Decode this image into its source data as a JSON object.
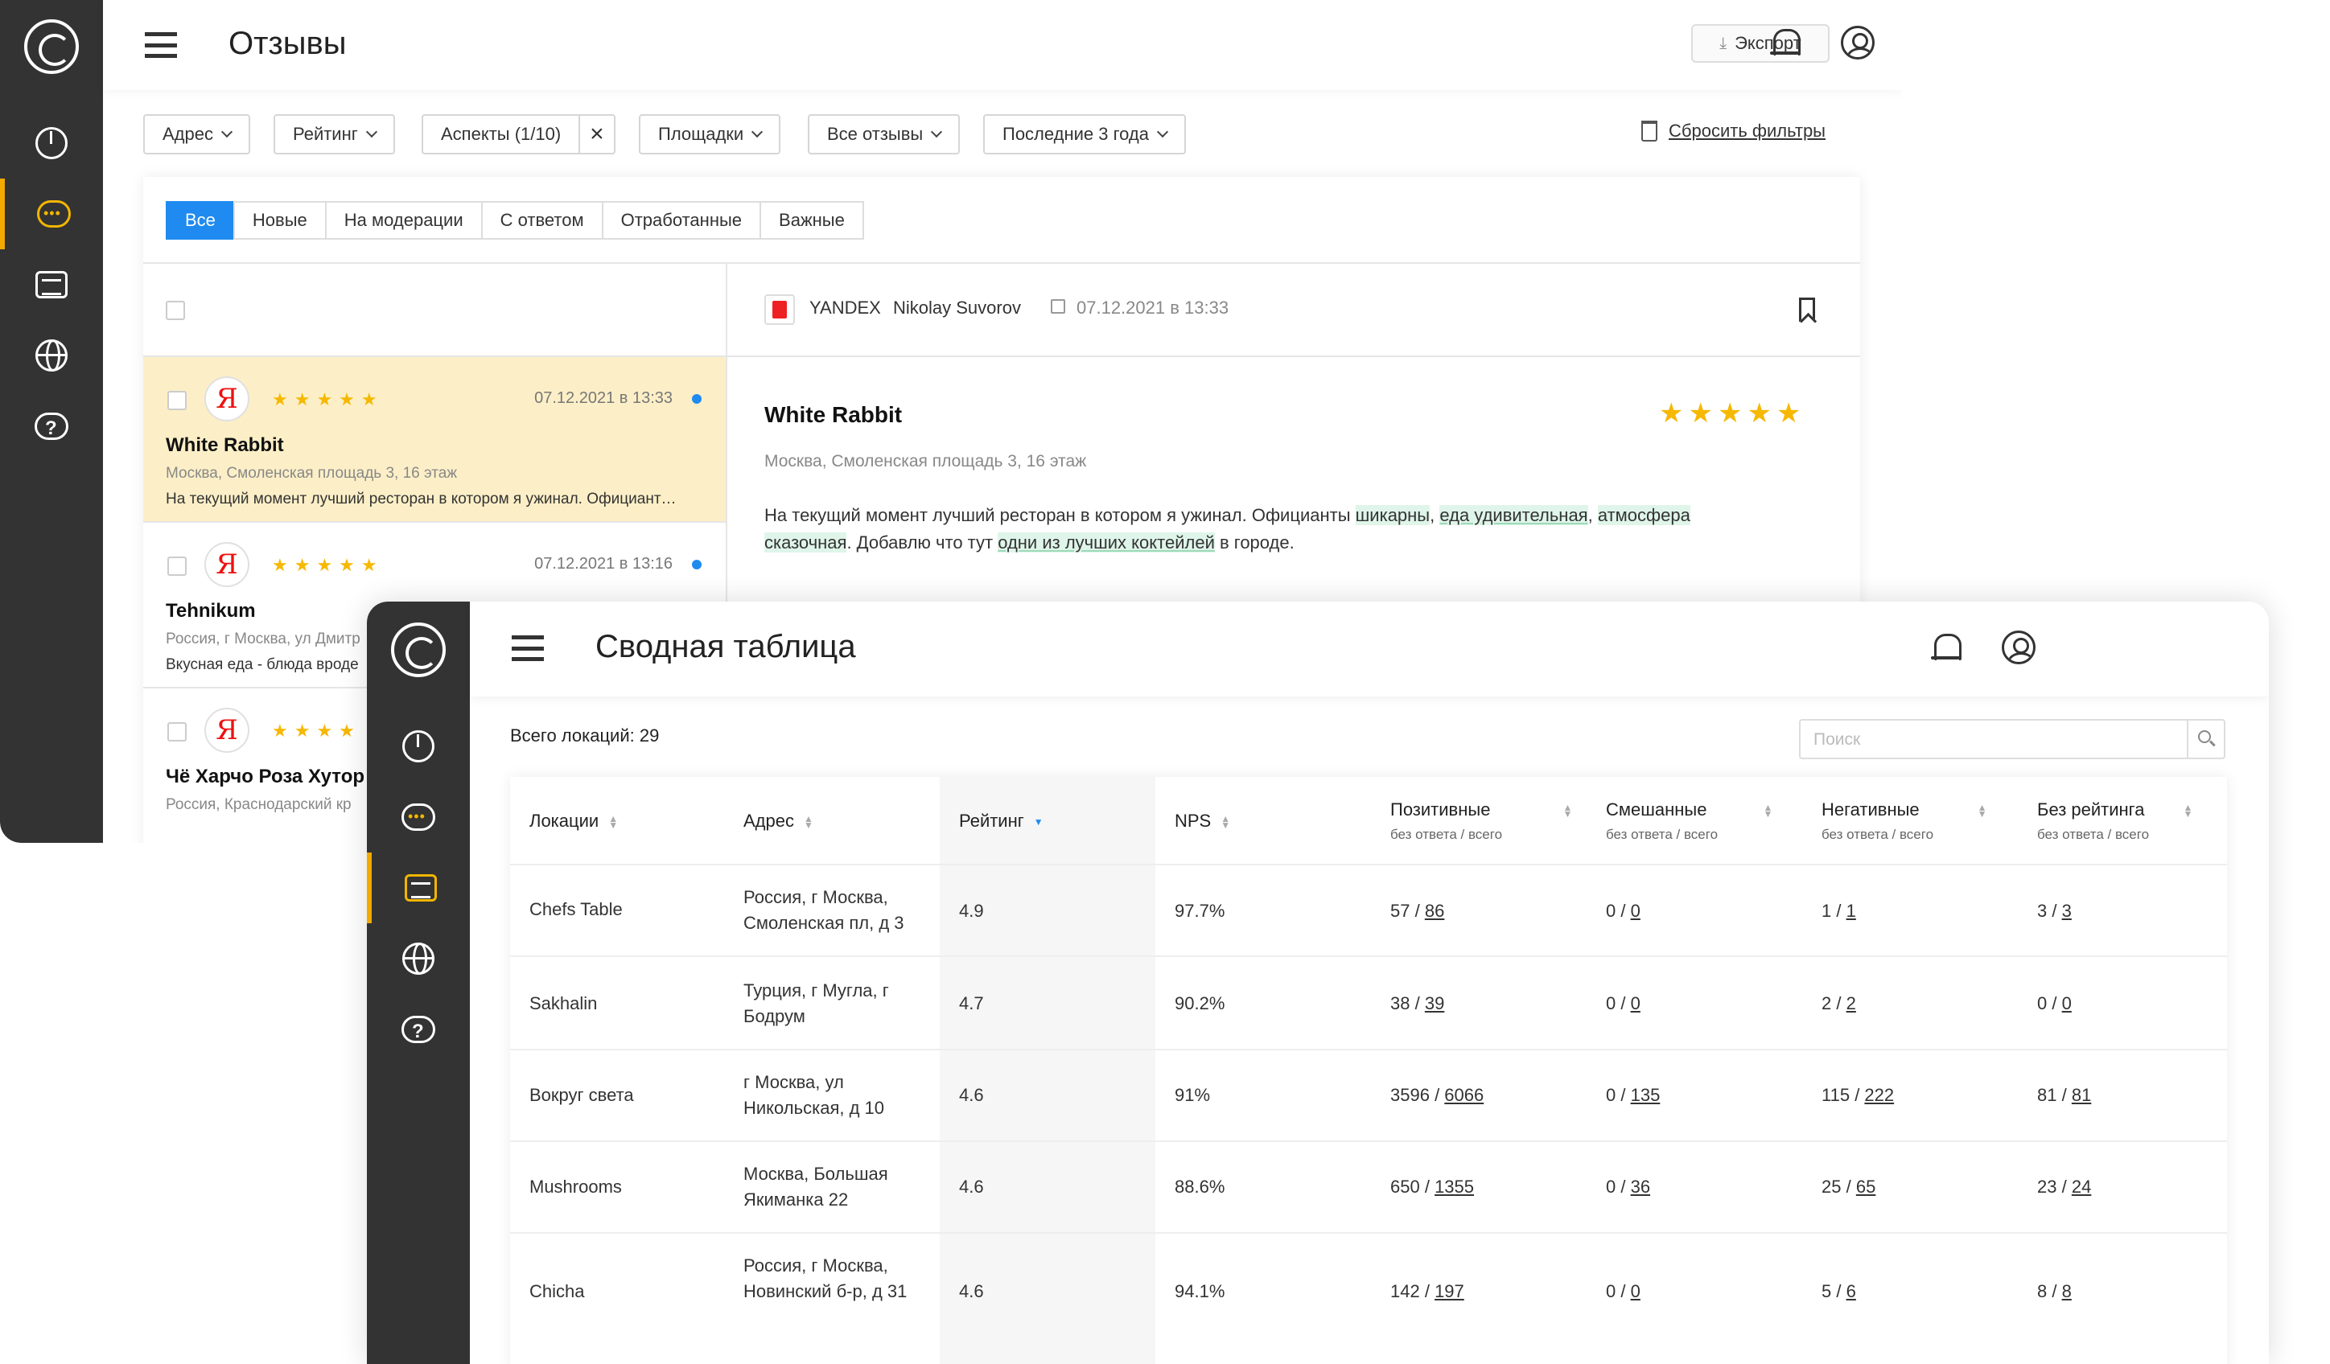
{
  "window_a": {
    "header": {
      "title": "Отзывы",
      "export_label": "Экспорт"
    },
    "filters": [
      {
        "label": "Адрес",
        "has_chevron": true
      },
      {
        "label": "Рейтинг",
        "has_chevron": true
      },
      {
        "label": "Аспекты (1/10)",
        "has_clear": true
      },
      {
        "label": "Площадки",
        "has_chevron": true
      },
      {
        "label": "Все отзывы",
        "has_chevron": true
      },
      {
        "label": "Последние 3 года",
        "has_chevron": true
      }
    ],
    "reset_label": "Сбросить фильтры",
    "tabs": [
      "Все",
      "Новые",
      "На модерации",
      "С ответом",
      "Отработанные",
      "Важные"
    ],
    "active_tab": "Все",
    "reviews": [
      {
        "stars": "★★★★★",
        "date": "07.12.2021 в 13:33",
        "name": "White Rabbit",
        "address": "Москва, Смоленская площадь 3, 16 этаж",
        "text": "На текущий момент лучший ресторан в котором я ужинал. Официант…",
        "selected": true
      },
      {
        "stars": "★★★★★",
        "date": "07.12.2021 в 13:16",
        "name": "Tehnikum",
        "address": "Россия, г Москва, ул Дмитр",
        "text": "Вкусная еда - блюда вроде",
        "selected": false
      },
      {
        "stars": "★★★★",
        "date": "",
        "name": "Чё Харчо Роза Хутор",
        "address": "Россия, Краснодарский кр",
        "text": "",
        "selected": false
      }
    ],
    "detail": {
      "platform": "YANDEX",
      "author": "Nikolay Suvorov",
      "date": "07.12.2021 в 13:33",
      "title": "White Rabbit",
      "stars": "★★★★★",
      "address": "Москва, Смоленская площадь 3, 16 этаж",
      "text_parts": {
        "p1": "На текущий момент лучший ресторан в котором я ужинал. Официанты ",
        "h1": "шикарны",
        "p2": ", ",
        "h2": "еда удивительная",
        "p3": ", ",
        "h3": "атмосфера сказочная",
        "p4": ". Добавлю что тут ",
        "h4": "одни из лучших коктейлей",
        "p5": " в городе."
      }
    },
    "colors": {
      "sidebar": "#333333",
      "accent": "#f2b600",
      "primary": "#1f8bf0",
      "selected_row": "#fcefc7",
      "highlight": "#dff5e9"
    }
  },
  "window_b": {
    "header": {
      "title": "Сводная таблица"
    },
    "total_label": "Всего локаций: 29",
    "search_placeholder": "Поиск",
    "columns": [
      {
        "label": "Локации",
        "sub": ""
      },
      {
        "label": "Адрес",
        "sub": ""
      },
      {
        "label": "Рейтинг",
        "sub": "",
        "sorted": true
      },
      {
        "label": "NPS",
        "sub": ""
      },
      {
        "label": "Позитивные",
        "sub": "без ответа / всего"
      },
      {
        "label": "Смешанные",
        "sub": "без ответа / всего"
      },
      {
        "label": "Негативные",
        "sub": "без ответа / всего"
      },
      {
        "label": "Без рейтинга",
        "sub": "без ответа / всего"
      }
    ],
    "rows": [
      {
        "location": "Chefs Table",
        "address": "Россия, г Москва, Смоленская пл, д 3",
        "rating": "4.9",
        "nps": "97.7%",
        "pos_a": "57",
        "pos_b": "86",
        "mix_a": "0",
        "mix_b": "0",
        "neg_a": "1",
        "neg_b": "1",
        "nr_a": "3",
        "nr_b": "3"
      },
      {
        "location": "Sakhalin",
        "address": "Турция, г Мугла, г Бодрум",
        "rating": "4.7",
        "nps": "90.2%",
        "pos_a": "38",
        "pos_b": "39",
        "mix_a": "0",
        "mix_b": "0",
        "neg_a": "2",
        "neg_b": "2",
        "nr_a": "0",
        "nr_b": "0"
      },
      {
        "location": "Вокруг света",
        "address": "г Москва, ул Никольская, д 10",
        "rating": "4.6",
        "nps": "91%",
        "pos_a": "3596",
        "pos_b": "6066",
        "mix_a": "0",
        "mix_b": "135",
        "neg_a": "115",
        "neg_b": "222",
        "nr_a": "81",
        "nr_b": "81"
      },
      {
        "location": "Mushrooms",
        "address": "Москва, Большая Якиманка 22",
        "rating": "4.6",
        "nps": "88.6%",
        "pos_a": "650",
        "pos_b": "1355",
        "mix_a": "0",
        "mix_b": "36",
        "neg_a": "25",
        "neg_b": "65",
        "nr_a": "23",
        "nr_b": "24"
      },
      {
        "location": "Chicha",
        "address": "Россия, г Москва, Новинский б-р, д 31",
        "rating": "4.6",
        "nps": "94.1%",
        "pos_a": "142",
        "pos_b": "197",
        "mix_a": "0",
        "mix_b": "0",
        "neg_a": "5",
        "neg_b": "6",
        "nr_a": "8",
        "nr_b": "8"
      }
    ]
  }
}
